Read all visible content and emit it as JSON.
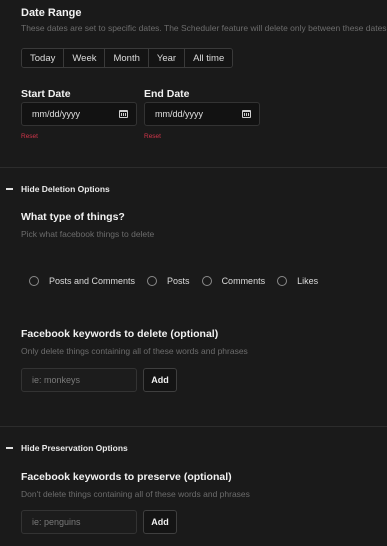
{
  "date_range": {
    "title": "Date Range",
    "description": "These dates are set to specific dates. The Scheduler feature will delete only between these dates.",
    "presets": [
      "Today",
      "Week",
      "Month",
      "Year",
      "All time"
    ],
    "start": {
      "label": "Start Date",
      "placeholder": "mm/dd/yyyy",
      "reset": "Reset"
    },
    "end": {
      "label": "End Date",
      "placeholder": "mm/dd/yyyy",
      "reset": "Reset"
    }
  },
  "deletion": {
    "toggle_label": "Hide Deletion Options",
    "type_title": "What type of things?",
    "type_subtitle": "Pick what facebook things to delete",
    "types": [
      "Posts and Comments",
      "Posts",
      "Comments",
      "Likes"
    ],
    "keywords_title": "Facebook keywords to delete (optional)",
    "keywords_subtitle": "Only delete things containing all of these words and phrases",
    "keywords_placeholder": "ie: monkeys",
    "add_label": "Add"
  },
  "preservation": {
    "toggle_label": "Hide Preservation Options",
    "keywords_title": "Facebook keywords to preserve (optional)",
    "keywords_subtitle": "Don't delete things containing all of these words and phrases",
    "keywords_placeholder": "ie: penguins",
    "add_label": "Add"
  },
  "colors": {
    "background": "#1a1a1a",
    "reset": "#d0354a",
    "muted": "#6c6c6c"
  }
}
